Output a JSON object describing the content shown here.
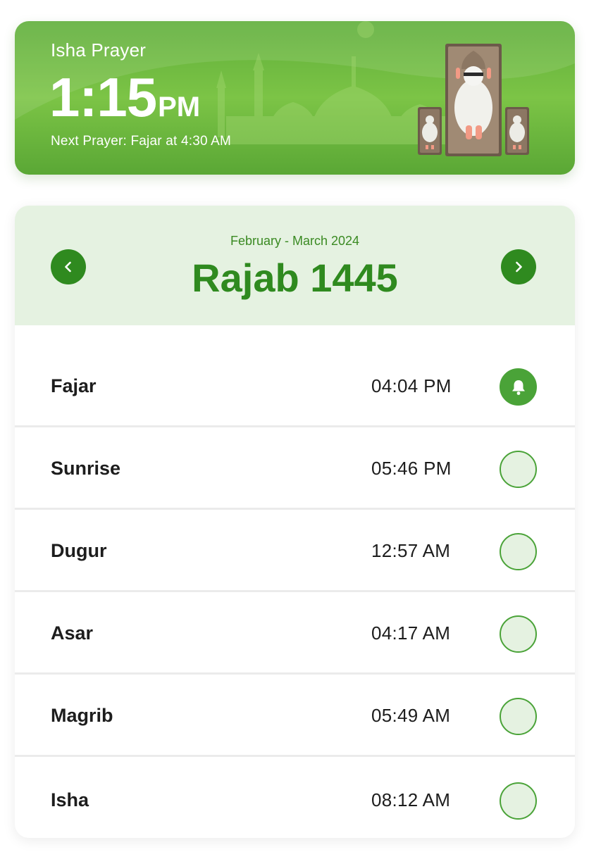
{
  "banner": {
    "title": "Isha Prayer",
    "time": "1:15",
    "ampm": "PM",
    "next_prayer": "Next Prayer: Fajar at 4:30 AM"
  },
  "calendar": {
    "month_range": "February - March 2024",
    "hijri_month": "Rajab 1445"
  },
  "prayers": [
    {
      "name": "Fajar",
      "time": "04:04 PM",
      "alert": true
    },
    {
      "name": "Sunrise",
      "time": "05:46 PM",
      "alert": false
    },
    {
      "name": "Dugur",
      "time": "12:57 AM",
      "alert": false
    },
    {
      "name": "Asar",
      "time": "04:17 AM",
      "alert": false
    },
    {
      "name": "Magrib",
      "time": "05:49 AM",
      "alert": false
    },
    {
      "name": "Isha",
      "time": "08:12 AM",
      "alert": false
    }
  ],
  "icons": {
    "prev": "chevron-left-icon",
    "next": "chevron-right-icon",
    "alert": "bell-icon"
  },
  "colors": {
    "accent": "#2f8a1f",
    "accent_light": "#e5f2e1",
    "toggle_active": "#4aa338"
  }
}
